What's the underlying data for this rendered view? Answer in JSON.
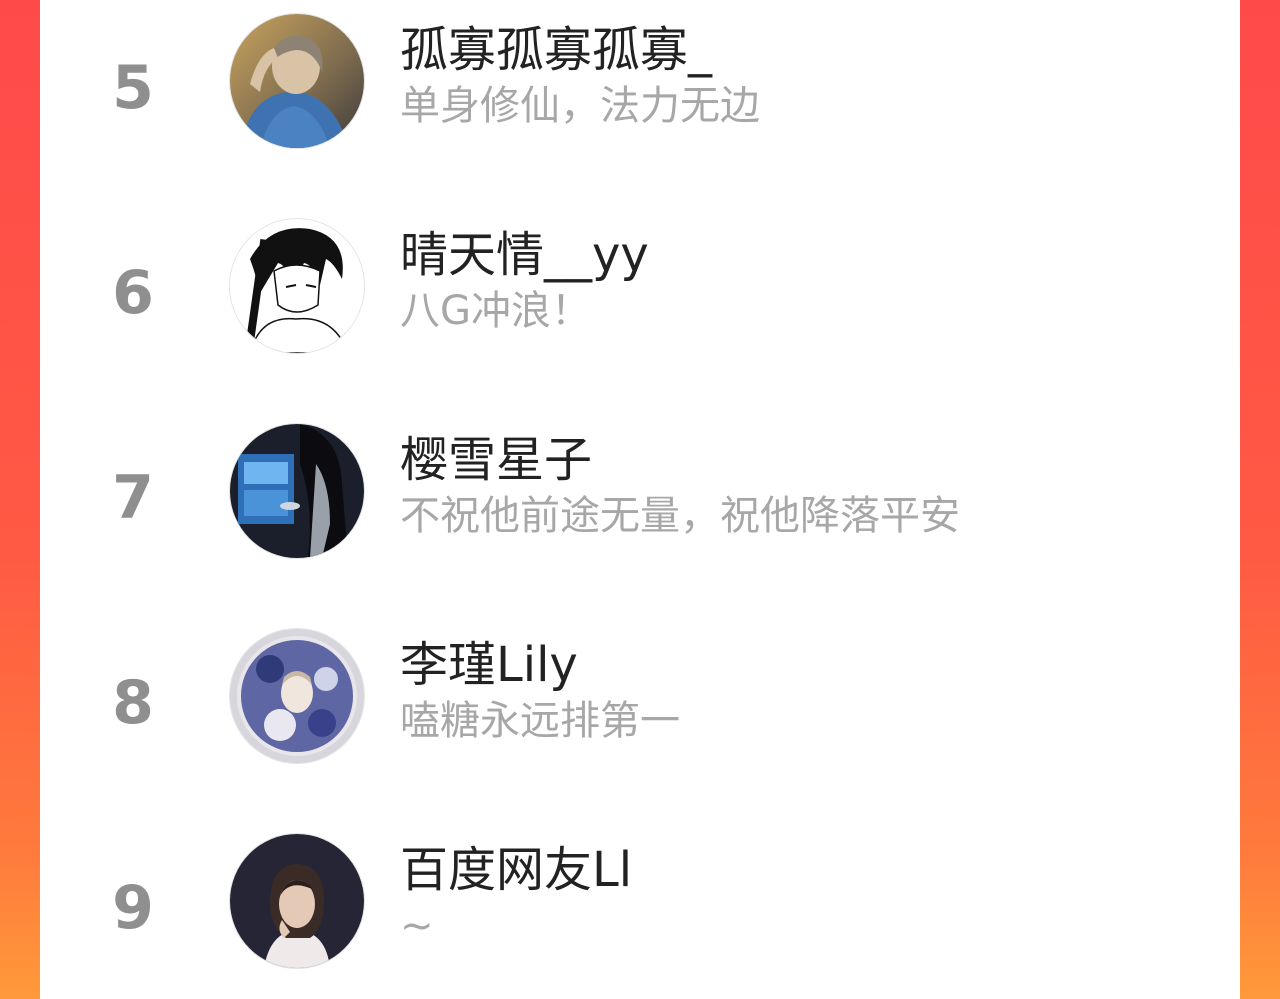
{
  "colors": {
    "background_gradient": [
      "#ff4a4a",
      "#ff7a3c",
      "#ff9a3a"
    ],
    "panel": "#ffffff",
    "rank_text": "#8f8f8f",
    "name_text": "#222222",
    "bio_text": "#a7a7a7"
  },
  "ranking": {
    "rows": [
      {
        "rank": "5",
        "name": "孤寡孤寡孤寡_",
        "bio": "单身修仙，法力无边",
        "avatar": "avatar-photo-woman-blue-jacket"
      },
      {
        "rank": "6",
        "name": "晴天情__yy",
        "bio": "八G冲浪！",
        "avatar": "avatar-manga-boy"
      },
      {
        "rank": "7",
        "name": "樱雪星子",
        "bio": "不祝他前途无量，祝他降落平安",
        "avatar": "avatar-photo-girl-fridge-light"
      },
      {
        "rank": "8",
        "name": "李瑾Lily",
        "bio": "嗑糖永远排第一",
        "avatar": "avatar-illustration-floral"
      },
      {
        "rank": "9",
        "name": "百度网友Ll",
        "bio": "~",
        "avatar": "avatar-photo-woman-dark"
      }
    ]
  }
}
